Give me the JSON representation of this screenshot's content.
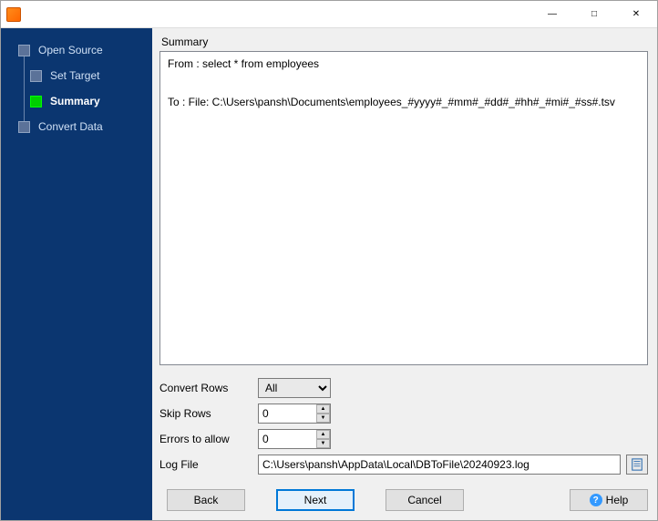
{
  "title": "",
  "sidebar": {
    "items": [
      {
        "label": "Open Source",
        "active": false
      },
      {
        "label": "Set Target",
        "active": false
      },
      {
        "label": "Summary",
        "active": true
      },
      {
        "label": "Convert Data",
        "active": false
      }
    ]
  },
  "main": {
    "summary_heading": "Summary",
    "summary_text": "From : select * from employees\n\n\nTo : File: C:\\Users\\pansh\\Documents\\employees_#yyyy#_#mm#_#dd#_#hh#_#mi#_#ss#.tsv",
    "fields": {
      "convert_rows_label": "Convert Rows",
      "convert_rows_value": "All",
      "skip_rows_label": "Skip Rows",
      "skip_rows_value": "0",
      "errors_label": "Errors to allow",
      "errors_value": "0",
      "log_label": "Log File",
      "log_value": "C:\\Users\\pansh\\AppData\\Local\\DBToFile\\20240923.log"
    }
  },
  "buttons": {
    "back": "Back",
    "next": "Next",
    "cancel": "Cancel",
    "help": "Help"
  }
}
